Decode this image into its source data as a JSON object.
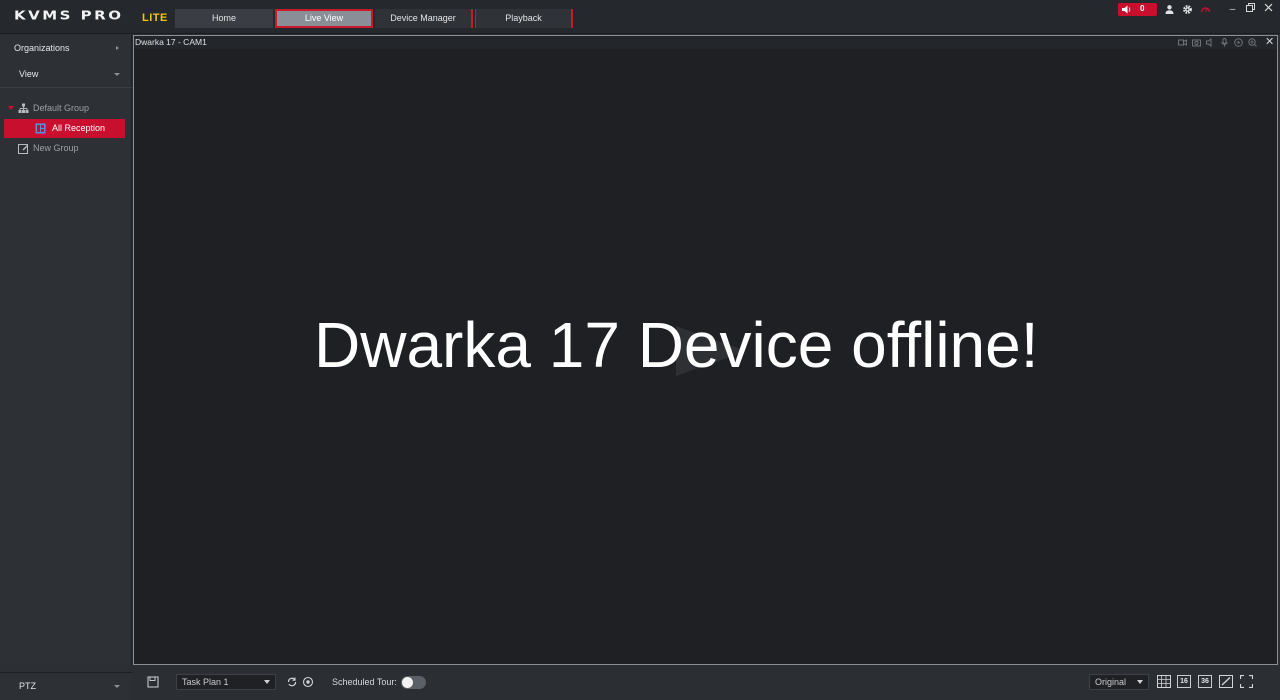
{
  "app": {
    "brand": "KVMS PRO",
    "edition": "LITE"
  },
  "nav": {
    "tabs": [
      {
        "label": "Home"
      },
      {
        "label": "Live View",
        "active": true
      },
      {
        "label": "Device Manager"
      },
      {
        "label": "Playback"
      }
    ]
  },
  "header": {
    "alarm_count": "0",
    "icons": [
      "speaker-icon",
      "user-icon",
      "gear-icon",
      "gauge-icon"
    ],
    "window_controls": [
      "minimize",
      "restore",
      "close"
    ]
  },
  "sidebar": {
    "organizations_label": "Organizations",
    "view_label": "View",
    "tree": [
      {
        "label": "Default Group",
        "expanded": true
      },
      {
        "label": "All Reception",
        "selected": true
      },
      {
        "label": "New Group"
      }
    ],
    "ptz_label": "PTZ"
  },
  "video": {
    "title": "Dwarka 17 - CAM1",
    "message": "Dwarka 17 Device offline!"
  },
  "bottom": {
    "task_plan": "Task Plan 1",
    "scheduled_tour_label": "Scheduled Tour:",
    "scheduled_tour_on": false,
    "aspect": "Original",
    "layout_16": "16",
    "layout_36": "36"
  },
  "colors": {
    "accent_red": "#c8102e",
    "lite_yellow": "#f0c419",
    "background": "#2b2e33",
    "video_bg": "#1e2024"
  }
}
